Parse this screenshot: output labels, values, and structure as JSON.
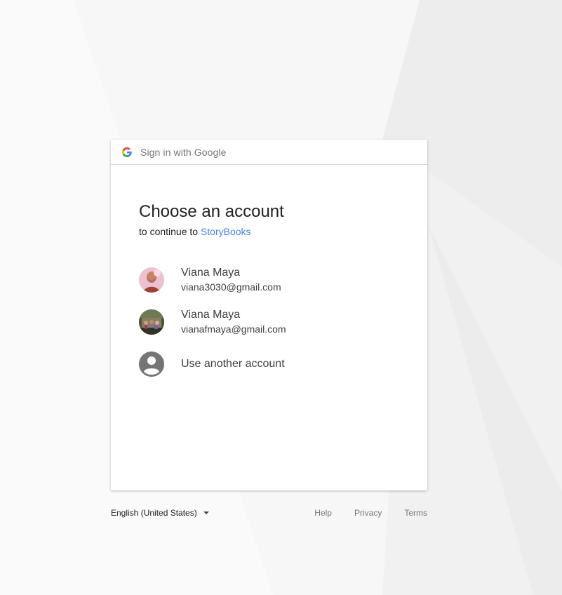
{
  "header": {
    "title": "Sign in with Google"
  },
  "main": {
    "title": "Choose an account",
    "subtitle_prefix": "to continue to",
    "app_name": "StoryBooks",
    "accounts": [
      {
        "name": "Viana Maya",
        "email": "viana3030@gmail.com",
        "avatar": "profile-photo"
      },
      {
        "name": "Viana Maya",
        "email": "vianafmaya@gmail.com",
        "avatar": "profile-photo"
      }
    ],
    "use_another_label": "Use another account",
    "use_another_icon": "account-circle-icon"
  },
  "footer": {
    "language": "English (United States)",
    "links": [
      "Help",
      "Privacy",
      "Terms"
    ]
  },
  "colors": {
    "link": "#4285f4",
    "google_blue": "#4285F4",
    "google_red": "#EA4335",
    "google_yellow": "#FBBC05",
    "google_green": "#34A853"
  }
}
